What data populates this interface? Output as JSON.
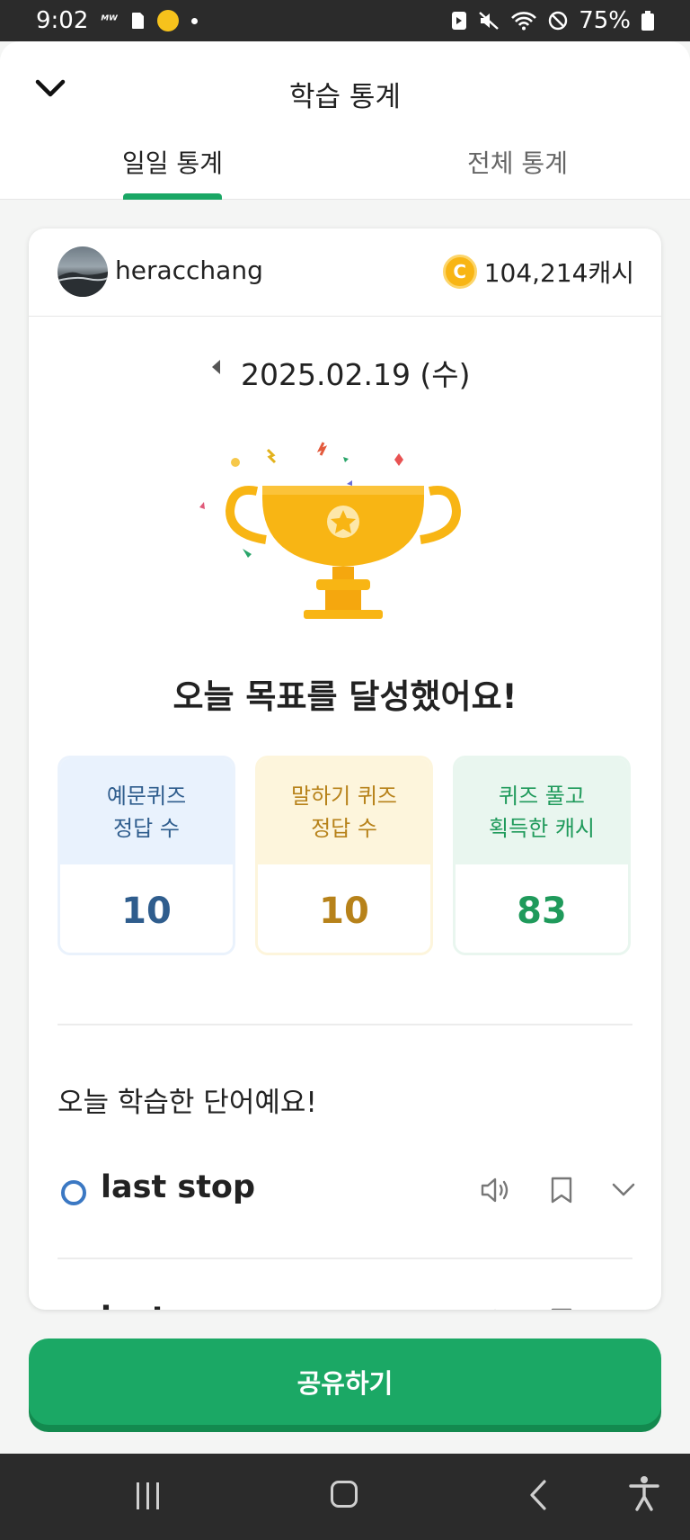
{
  "status_bar": {
    "time": "9:02",
    "carrier_badge": "ᴹᵂ",
    "battery": "75%"
  },
  "header": {
    "title": "학습 통계",
    "tabs": [
      {
        "label": "일일 통계",
        "active": true
      },
      {
        "label": "전체 통계",
        "active": false
      }
    ]
  },
  "user": {
    "name": "heracchang",
    "cash": "104,214캐시"
  },
  "date": "2025.02.19 (수)",
  "goal_message": "오늘 목표를 달성했어요!",
  "stats": [
    {
      "line1": "예문퀴즈",
      "line2": "정답 수",
      "value": "10"
    },
    {
      "line1": "말하기 퀴즈",
      "line2": "정답 수",
      "value": "10"
    },
    {
      "line1": "퀴즈 풀고",
      "line2": "획득한 캐시",
      "value": "83"
    }
  ],
  "words_section_title": "오늘 학습한 단어예요!",
  "words": [
    {
      "text": "last stop"
    },
    {
      "text": "last"
    }
  ],
  "share_button": "공유하기",
  "colors": {
    "accent_green": "#1ba865",
    "stat_blue": "#2f5d8d",
    "stat_gold": "#b7821a",
    "stat_green": "#1f9a5b",
    "trophy": "#f8b514"
  },
  "icons": {
    "back": "chevron-down-icon",
    "coin": "coin-icon",
    "prev_date": "caret-left-icon",
    "speaker": "speaker-icon",
    "bookmark": "bookmark-icon",
    "expand": "chevron-down-icon"
  }
}
